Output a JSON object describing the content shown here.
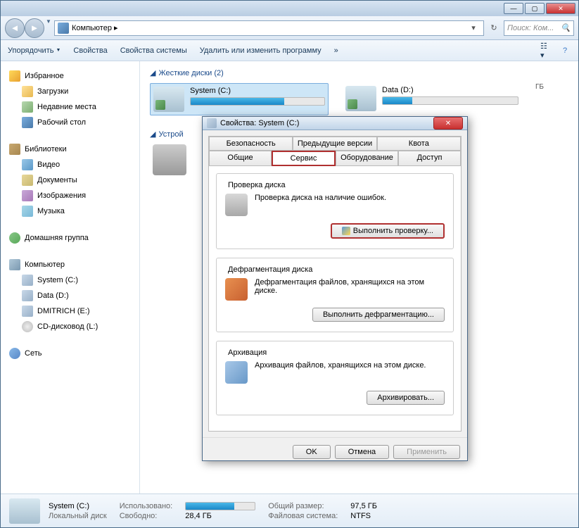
{
  "titlebar": {
    "min": "—",
    "max": "▢",
    "close": "✕"
  },
  "nav": {
    "address": "Компьютер ▸",
    "search_placeholder": "Поиск: Ком..."
  },
  "toolbar": {
    "organize": "Упорядочить",
    "properties": "Свойства",
    "system_properties": "Свойства системы",
    "uninstall": "Удалить или изменить программу",
    "more": "»"
  },
  "sidebar": {
    "favorites": "Избранное",
    "downloads": "Загрузки",
    "recent": "Недавние места",
    "desktop": "Рабочий стол",
    "libraries": "Библиотеки",
    "videos": "Видео",
    "documents": "Документы",
    "pictures": "Изображения",
    "music": "Музыка",
    "homegroup": "Домашняя группа",
    "computer": "Компьютер",
    "drive_c": "System (C:)",
    "drive_d": "Data (D:)",
    "drive_e": "DMITRICH (E:)",
    "drive_cd": "CD-дисковод (L:)",
    "network": "Сеть"
  },
  "main": {
    "hard_drives": "Жесткие диски (2)",
    "devices": "Устрой",
    "drives": [
      {
        "label": "System (C:)",
        "fill": 70
      },
      {
        "label": "Data (D:)",
        "fill": 22
      }
    ],
    "data_d_info": "ГБ",
    "expand_icon": "◢"
  },
  "dialog": {
    "title": "Свойства: System (C:)",
    "tabs_row1": [
      "Безопасность",
      "Предыдущие версии",
      "Квота"
    ],
    "tabs_row2": [
      "Общие",
      "Сервис",
      "Оборудование",
      "Доступ"
    ],
    "selected_tab": "Сервис",
    "check": {
      "legend": "Проверка диска",
      "text": "Проверка диска на наличие ошибок.",
      "button": "Выполнить проверку..."
    },
    "defrag": {
      "legend": "Дефрагментация диска",
      "text": "Дефрагментация файлов, хранящихся на этом диске.",
      "button": "Выполнить дефрагментацию..."
    },
    "backup": {
      "legend": "Архивация",
      "text": "Архивация файлов, хранящихся на этом диске.",
      "button": "Архивировать..."
    },
    "ok": "OK",
    "cancel": "Отмена",
    "apply": "Применить"
  },
  "status": {
    "drive": "System (C:)",
    "type": "Локальный диск",
    "used_label": "Использовано:",
    "free_label": "Свободно:",
    "free_val": "28,4 ГБ",
    "total_label": "Общий размер:",
    "total_val": "97,5 ГБ",
    "fs_label": "Файловая система:",
    "fs_val": "NTFS"
  }
}
